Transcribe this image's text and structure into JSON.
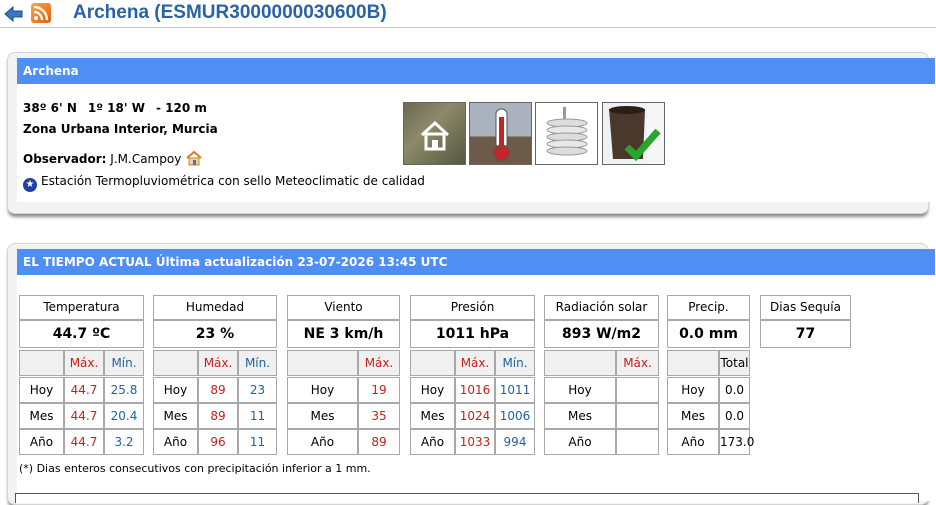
{
  "header": {
    "title": "Archena (ESMUR3000000030600B)",
    "back_icon": "back-arrow-icon",
    "rss_icon": "rss-feed-icon"
  },
  "station": {
    "bar_title": "Archena",
    "lat": "38º 6' N",
    "lon": "1º 18' W",
    "alt": "- 120 m",
    "zona": "Zona Urbana Interior, Murcia",
    "observer_label": "Observador:",
    "observer": "J.M.Campoy",
    "quality": "Estación Termopluviométrica con sello Meteoclimatic de calidad",
    "images": [
      "aerial-photo",
      "thermometer-photo",
      "radiation-shield-photo",
      "rain-gauge-photo"
    ]
  },
  "weather": {
    "bar_title": "EL TIEMPO ACTUAL Última actualización 23-07-2026 13:45 UTC",
    "boxes": [
      {
        "label": "Temperatura",
        "value": "44.7 ºC"
      },
      {
        "label": "Humedad",
        "value": "23 %"
      },
      {
        "label": "Viento",
        "value": "NE  3 km/h"
      },
      {
        "label": "Presión",
        "value": "1011 hPa"
      },
      {
        "label": "Radiación solar",
        "value": "893 W/m2"
      },
      {
        "label": "Precip.",
        "value": "0.0 mm"
      },
      {
        "label": "Dias Sequía (*)",
        "value": "77"
      }
    ],
    "max": "Máx.",
    "min": "Mín.",
    "total": "Total",
    "rows": [
      "Hoy",
      "Mes",
      "Año"
    ],
    "temp": {
      "max": [
        "44.7",
        "44.7",
        "44.7"
      ],
      "min": [
        "25.8",
        "20.4",
        "3.2"
      ]
    },
    "hum": {
      "max": [
        "89",
        "89",
        "96"
      ],
      "min": [
        "23",
        "11",
        "11"
      ]
    },
    "wind": {
      "max": [
        "19",
        "35",
        "89"
      ]
    },
    "pres": {
      "max": [
        "1016",
        "1024",
        "1033"
      ],
      "min": [
        "1011",
        "1006",
        "994"
      ]
    },
    "rad": {
      "max": [
        "",
        "",
        ""
      ]
    },
    "precip": {
      "total": [
        "0.0",
        "0.0",
        "173.0"
      ]
    },
    "note": "(*) Dias enteros consecutivos con precipitación inferior a 1 mm."
  }
}
